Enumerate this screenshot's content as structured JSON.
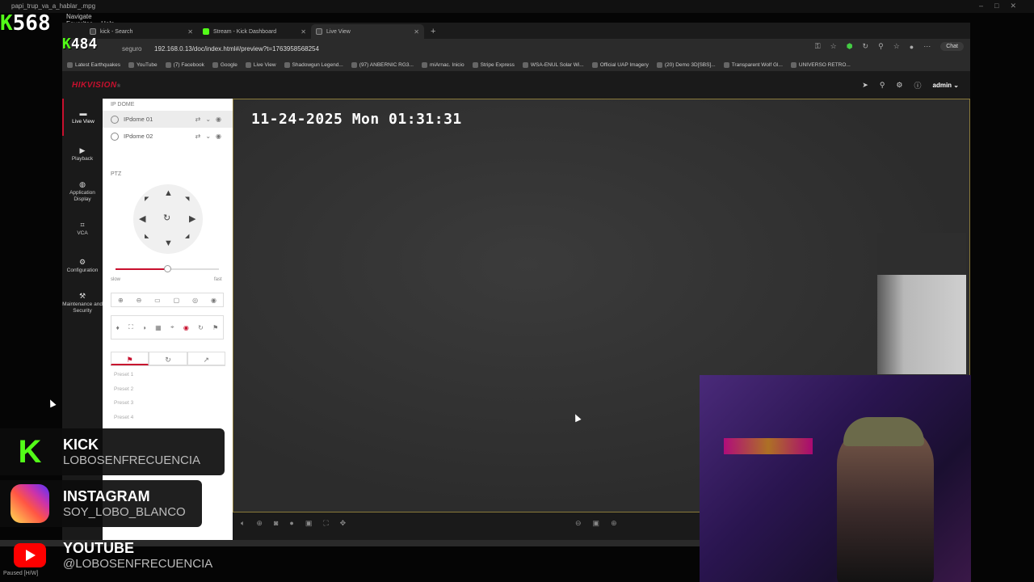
{
  "player": {
    "title": "papi_trup_va_a_hablar_.mpg",
    "menu": [
      "Navigate",
      "Favorites",
      "Help"
    ],
    "status": "Paused [H/W]"
  },
  "kick_counters": {
    "top": "568",
    "second": "484"
  },
  "browser": {
    "tabs": [
      {
        "label": "kick - Search",
        "active": false
      },
      {
        "label": "Stream - Kick Dashboard",
        "active": false
      },
      {
        "label": "Live View",
        "active": true
      }
    ],
    "security_label": "seguro",
    "url": "192.168.0.13/doc/index.html#/preview?t=1763958568254",
    "chat_label": "Chat",
    "bookmarks": [
      "Latest Earthquakes",
      "YouTube",
      "(7) Facebook",
      "Google",
      "Live View",
      "Shadowgun Legend...",
      "(97) ANBERNIC RG3...",
      "miArnac. Inicio",
      "Stripe Express",
      "WSA-ENUL Solar Wi...",
      "Official UAP Imagery",
      "(20) Demo 3D[SBS]...",
      "Transparent Wolf Gl...",
      "UNIVERSO RETRO..."
    ]
  },
  "hikvision": {
    "logo": "HIKVISION",
    "user": "admin",
    "nav": [
      {
        "label": "Live View",
        "icon": "camera-icon",
        "active": true
      },
      {
        "label": "Playback",
        "icon": "playback-icon",
        "active": false
      },
      {
        "label": "Application Display",
        "icon": "chart-icon",
        "active": false
      },
      {
        "label": "VCA",
        "icon": "vca-icon",
        "active": false
      },
      {
        "label": "Configuration",
        "icon": "gear-icon",
        "active": false
      },
      {
        "label": "Maintenance and Security",
        "icon": "wrench-icon",
        "active": false
      }
    ],
    "section_title": "IP DOME",
    "cameras": [
      {
        "name": "IPdome 01",
        "selected": true
      },
      {
        "name": "IPdome 02",
        "selected": false
      }
    ],
    "ptz_title": "PTZ",
    "speed": {
      "slow": "slow",
      "fast": "fast",
      "level": 0.5
    },
    "presets": [
      "Preset 1",
      "Preset 2",
      "Preset 3",
      "Preset 4"
    ],
    "osd_timestamp": "11-24-2025 Mon 01:31:31"
  },
  "overlays": {
    "kick": {
      "title": "KICK",
      "handle": "LOBOSENFRECUENCIA"
    },
    "instagram": {
      "title": "INSTAGRAM",
      "handle": "SOY_LOBO_BLANCO"
    },
    "youtube": {
      "title": "YOUTUBE",
      "handle": "@LOBOSENFRECUENCIA"
    }
  },
  "colors": {
    "hik_red": "#c8102e",
    "kick_green": "#53fc18"
  }
}
